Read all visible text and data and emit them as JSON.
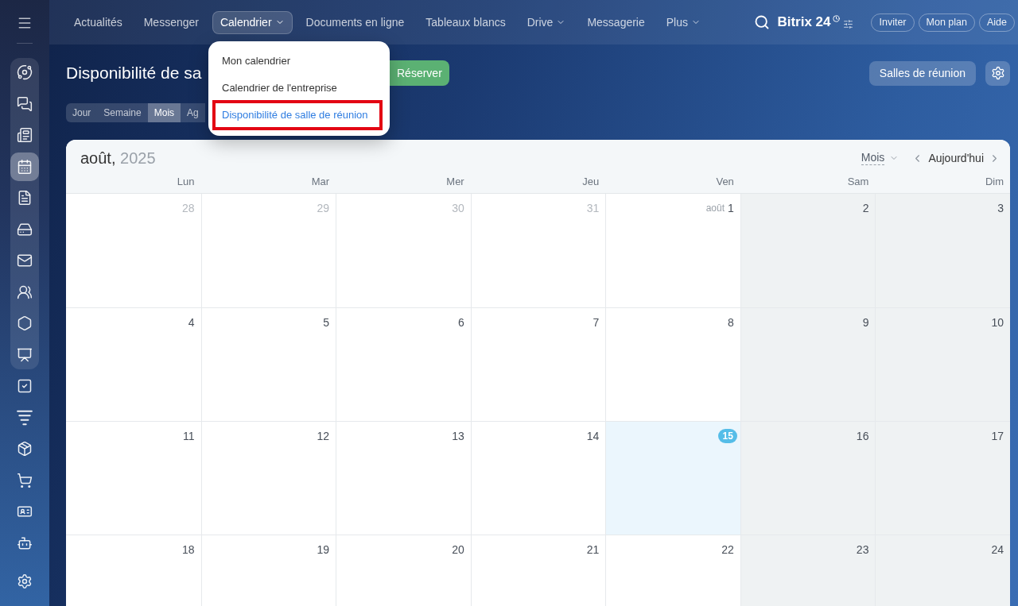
{
  "sidebar": {
    "group": [
      {
        "selected": false
      },
      {
        "selected": false
      },
      {
        "selected": false
      },
      {
        "selected": true
      },
      {
        "selected": false
      },
      {
        "selected": false
      },
      {
        "selected": false
      },
      {
        "selected": false
      },
      {
        "selected": false
      },
      {
        "selected": false
      }
    ],
    "items": [
      {
        "selected": false
      },
      {
        "selected": false
      },
      {
        "selected": false
      },
      {
        "selected": false
      },
      {
        "selected": false
      },
      {
        "selected": false
      }
    ]
  },
  "nav": [
    {
      "label": "Actualités",
      "selected": false,
      "has_menu": false
    },
    {
      "label": "Messenger",
      "selected": false,
      "has_menu": false
    },
    {
      "label": "Calendrier",
      "selected": true,
      "has_menu": true
    },
    {
      "label": "Documents en ligne",
      "selected": false,
      "has_menu": false
    },
    {
      "label": "Tableaux blancs",
      "selected": false,
      "has_menu": false
    },
    {
      "label": "Drive",
      "selected": false,
      "has_menu": true
    },
    {
      "label": "Messagerie",
      "selected": false,
      "has_menu": false
    },
    {
      "label": "Plus",
      "selected": false,
      "has_menu": true
    }
  ],
  "logo": {
    "text": "Bitrix 24"
  },
  "header_buttons": [
    "Inviter",
    "Mon plan",
    "Aide"
  ],
  "nav_menu": {
    "items": [
      {
        "label": "Mon calendrier",
        "selected": false,
        "annotated": false
      },
      {
        "label": "Calendrier de l'entreprise",
        "selected": false,
        "annotated": false
      },
      {
        "label": "Disponibilité de salle de réunion",
        "selected": true,
        "annotated": true
      }
    ]
  },
  "page": {
    "title": "Disponibilité de sa",
    "primary_button": "Réserver",
    "view_tabs": [
      {
        "label": "Jour",
        "selected": false
      },
      {
        "label": "Semaine",
        "selected": false
      },
      {
        "label": "Mois",
        "selected": true
      },
      {
        "label": "Ag",
        "selected": false
      }
    ],
    "rooms_button": "Salles de réunion"
  },
  "calendar": {
    "month": "août,",
    "year": "2025",
    "view_select": "Mois",
    "today_button": "Aujourd'hui",
    "weekdays": [
      {
        "label": "Lun",
        "weekend": false
      },
      {
        "label": "Mar",
        "weekend": false
      },
      {
        "label": "Mer",
        "weekend": false
      },
      {
        "label": "Jeu",
        "weekend": false
      },
      {
        "label": "Ven",
        "weekend": false
      },
      {
        "label": "Sam",
        "weekend": true
      },
      {
        "label": "Dim",
        "weekend": true
      }
    ],
    "weeks": [
      [
        {
          "day": "28",
          "other_month": true,
          "today": false
        },
        {
          "day": "29",
          "other_month": true,
          "today": false
        },
        {
          "day": "30",
          "other_month": true,
          "today": false
        },
        {
          "day": "31",
          "other_month": true,
          "today": false
        },
        {
          "day": "1",
          "month_label": "août",
          "other_month": false,
          "today": false
        },
        {
          "day": "2",
          "other_month": false,
          "today": false
        },
        {
          "day": "3",
          "other_month": false,
          "today": false
        }
      ],
      [
        {
          "day": "4",
          "other_month": false,
          "today": false
        },
        {
          "day": "5",
          "other_month": false,
          "today": false
        },
        {
          "day": "6",
          "other_month": false,
          "today": false
        },
        {
          "day": "7",
          "other_month": false,
          "today": false
        },
        {
          "day": "8",
          "other_month": false,
          "today": false
        },
        {
          "day": "9",
          "other_month": false,
          "today": false
        },
        {
          "day": "10",
          "other_month": false,
          "today": false
        }
      ],
      [
        {
          "day": "11",
          "other_month": false,
          "today": false
        },
        {
          "day": "12",
          "other_month": false,
          "today": false
        },
        {
          "day": "13",
          "other_month": false,
          "today": false
        },
        {
          "day": "14",
          "other_month": false,
          "today": false
        },
        {
          "day": "15",
          "other_month": false,
          "today": true
        },
        {
          "day": "16",
          "other_month": false,
          "today": false
        },
        {
          "day": "17",
          "other_month": false,
          "today": false
        }
      ],
      [
        {
          "day": "18",
          "other_month": false,
          "today": false
        },
        {
          "day": "19",
          "other_month": false,
          "today": false
        },
        {
          "day": "20",
          "other_month": false,
          "today": false
        },
        {
          "day": "21",
          "other_month": false,
          "today": false
        },
        {
          "day": "22",
          "other_month": false,
          "today": false
        },
        {
          "day": "23",
          "other_month": false,
          "today": false
        },
        {
          "day": "24",
          "other_month": false,
          "today": false
        }
      ]
    ]
  }
}
